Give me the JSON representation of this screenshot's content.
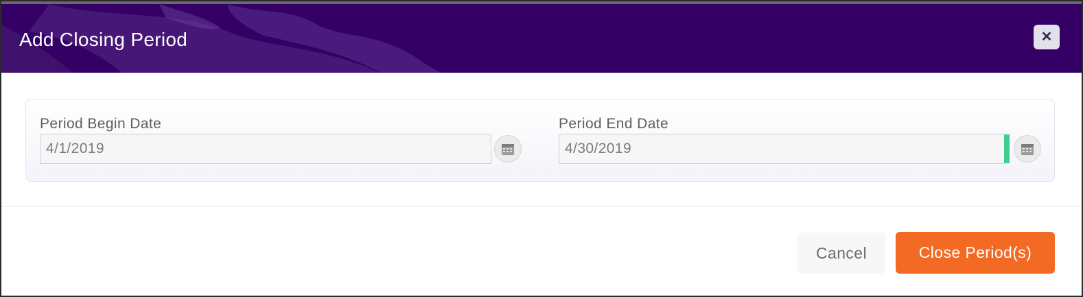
{
  "dialog": {
    "title": "Add Closing Period",
    "close_icon": "close-icon"
  },
  "form": {
    "begin": {
      "label": "Period Begin Date",
      "value": "4/1/2019",
      "icon": "calendar-icon"
    },
    "end": {
      "label": "Period End Date",
      "value": "4/30/2019",
      "icon": "calendar-icon"
    }
  },
  "footer": {
    "cancel_label": "Cancel",
    "submit_label": "Close Period(s)"
  },
  "colors": {
    "header": "#340066",
    "primary_button": "#f26a24",
    "focus_indicator": "#3ecf8e"
  }
}
